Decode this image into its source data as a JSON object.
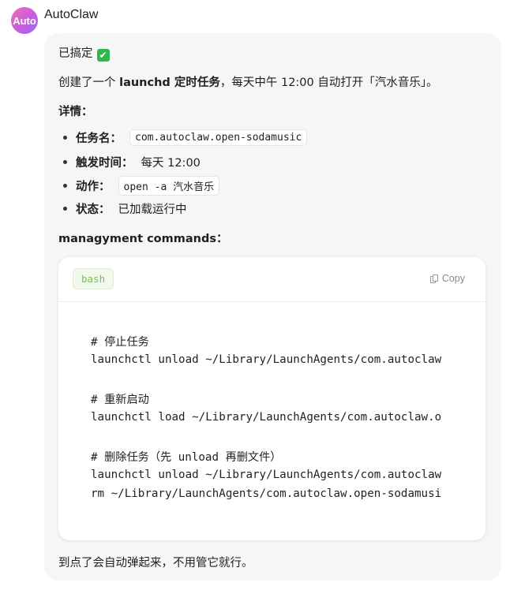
{
  "header": {
    "avatar_text": "Auto",
    "app_name": "AutoClaw"
  },
  "message": {
    "done_text": "已搞定",
    "done_emoji": "✔",
    "intro_pre": "创建了一个",
    "intro_bold": "launchd 定时任务",
    "intro_post": "，每天中午 12:00 自动打开「汽水音乐」。",
    "details_title": "详情：",
    "details": [
      {
        "label": "任务名：",
        "value": "com.autoclaw.open-sodamusic",
        "code": true
      },
      {
        "label": "触发时间：",
        "value": "每天 12:00",
        "code": false
      },
      {
        "label": "动作：",
        "value": "open -a 汽水音乐",
        "code": true
      },
      {
        "label": "状态：",
        "value": "已加载运行中",
        "code": false
      }
    ],
    "commands_title": "managyment commands：",
    "code_block": {
      "language": "bash",
      "copy_label": "Copy",
      "lines": [
        "# 停止任务",
        "launchctl unload ~/Library/LaunchAgents/com.autoclaw",
        "",
        "# 重新启动",
        "launchctl load ~/Library/LaunchAgents/com.autoclaw.o",
        "",
        "# 删除任务（先 unload 再删文件）",
        "launchctl unload ~/Library/LaunchAgents/com.autoclaw",
        "rm ~/Library/LaunchAgents/com.autoclaw.open-sodamusi"
      ]
    },
    "footer_text": "到点了会自动弹起来，不用管它就行。"
  }
}
